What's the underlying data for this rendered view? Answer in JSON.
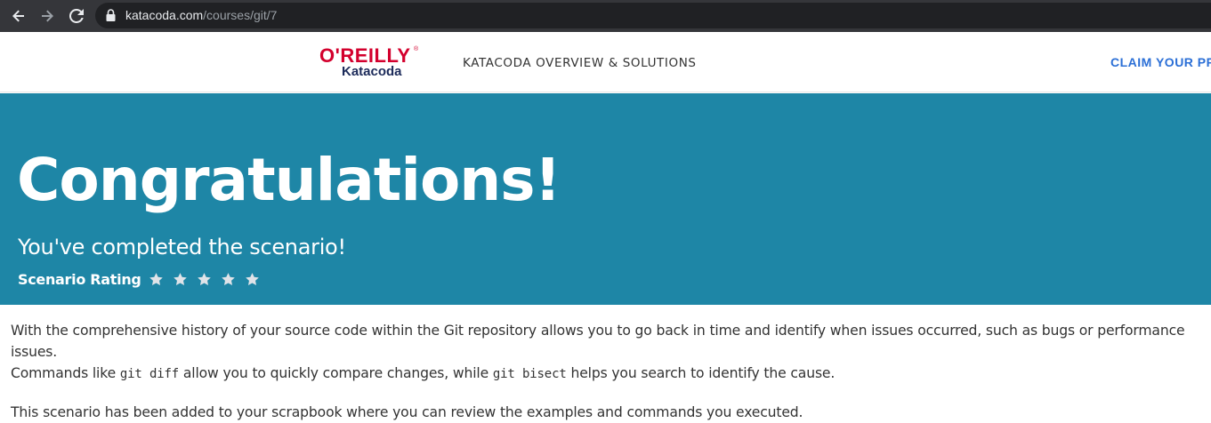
{
  "browser": {
    "url_host": "katacoda.com",
    "url_path": "/courses/git/7",
    "icons": [
      "back-arrow-icon",
      "forward-arrow-icon",
      "reload-icon",
      "lock-icon"
    ]
  },
  "header": {
    "logo_brand": "O'REILLY",
    "logo_product": "Katacoda",
    "nav_link": "KATACODA OVERVIEW & SOLUTIONS",
    "claim_link": "CLAIM YOUR PR"
  },
  "hero": {
    "title": "Congratulations!",
    "subtitle": "You've completed the scenario!",
    "rating_label": "Scenario Rating",
    "rating_stars": 5,
    "background_color": "#1e86a6",
    "star_color": "#dfe3e8"
  },
  "content": {
    "p1_text": "With the comprehensive history of your source code within the Git repository allows you to go back in time and identify when issues occurred, such as bugs or performance issues.",
    "p1_line2_prefix": "Commands like ",
    "p1_code1": "git diff",
    "p1_line2_middle": " allow you to quickly compare changes, while ",
    "p1_code2": "git bisect",
    "p1_line2_suffix": " helps you search to identify the cause.",
    "p2_text": "This scenario has been added to your scrapbook where you can review the examples and commands you executed."
  }
}
